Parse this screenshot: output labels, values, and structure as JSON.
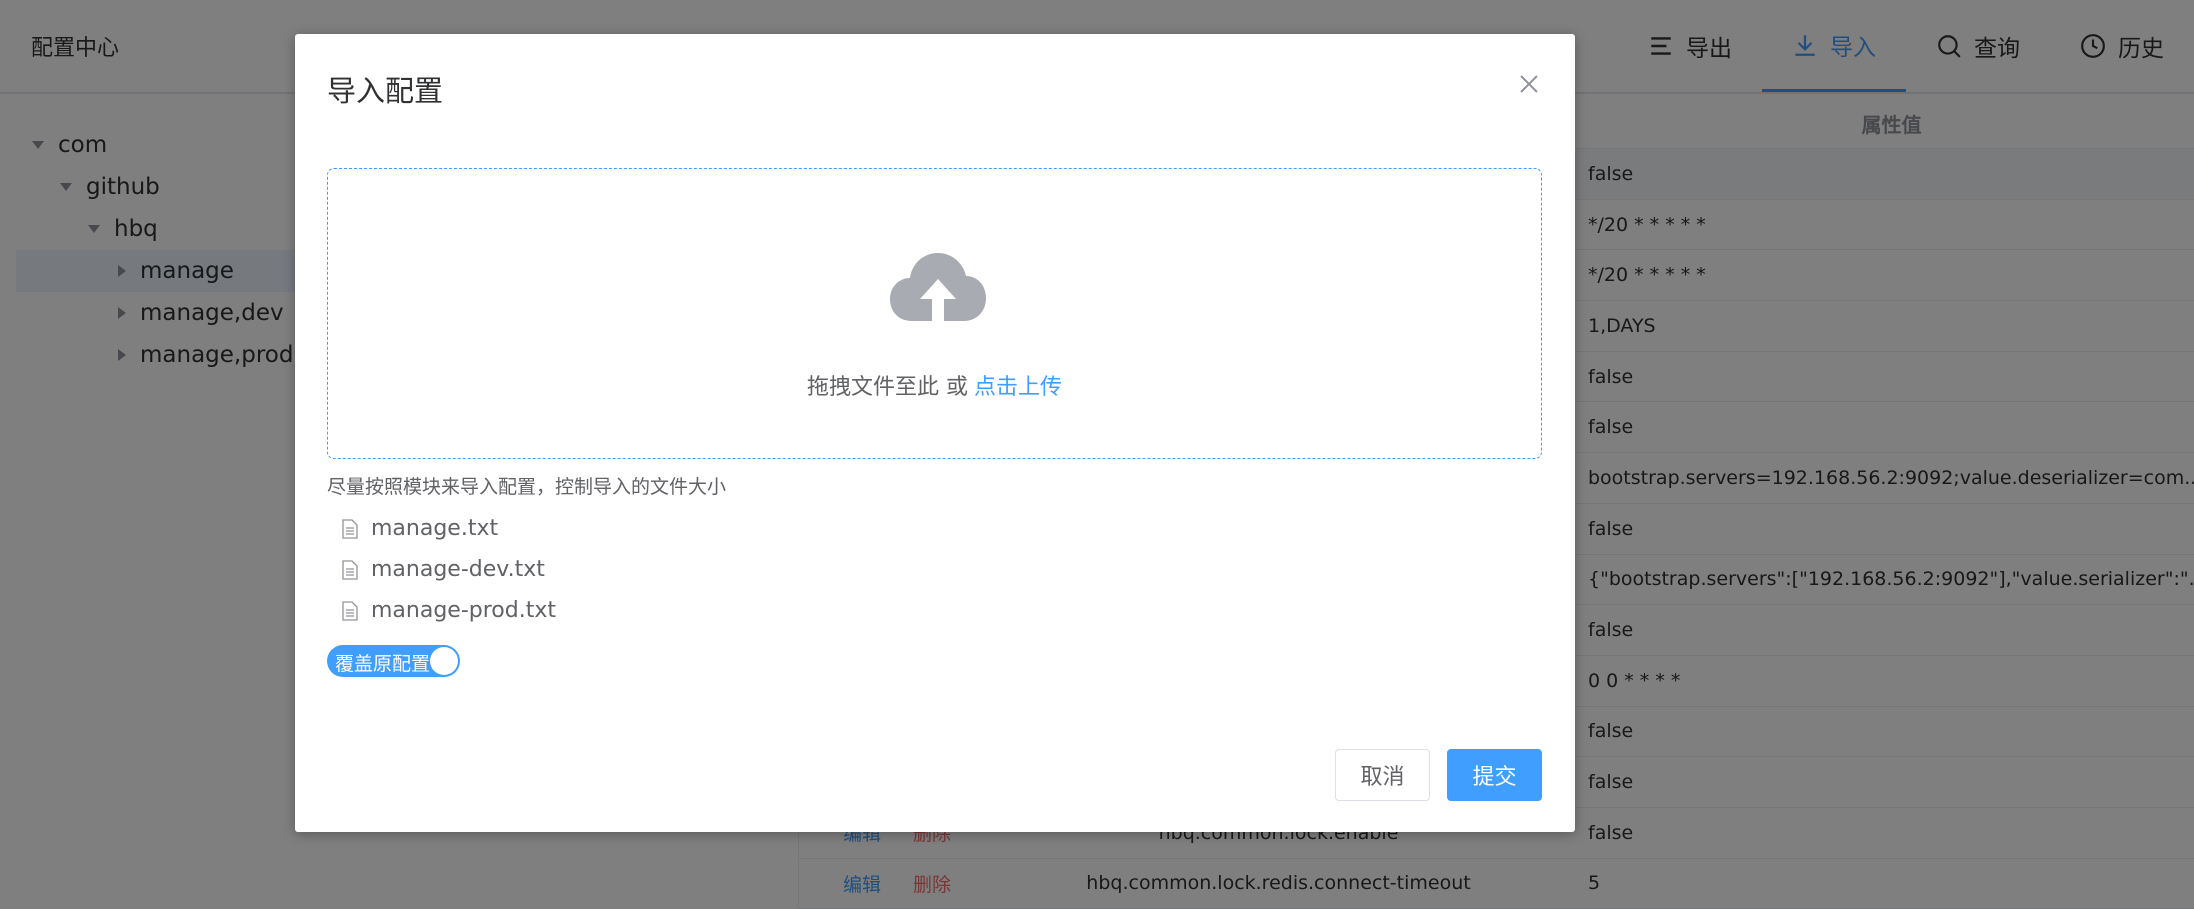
{
  "app": {
    "title": "配置中心"
  },
  "nav": [
    {
      "label": "导出",
      "icon": "export-icon",
      "active": false
    },
    {
      "label": "导入",
      "icon": "import-icon",
      "active": true
    },
    {
      "label": "查询",
      "icon": "search-icon",
      "active": false
    },
    {
      "label": "历史",
      "icon": "history-icon",
      "active": false
    }
  ],
  "tree": [
    {
      "label": "com",
      "expanded": true,
      "level": 0
    },
    {
      "label": "github",
      "expanded": true,
      "level": 1
    },
    {
      "label": "hbq",
      "expanded": true,
      "level": 2
    },
    {
      "label": "manage",
      "expanded": false,
      "level": 3,
      "selected": true
    },
    {
      "label": "manage,dev",
      "expanded": false,
      "level": 3
    },
    {
      "label": "manage,prod",
      "expanded": false,
      "level": 3
    }
  ],
  "table": {
    "value_header": "属性值",
    "edit_label": "编辑",
    "delete_label": "删除",
    "rows": [
      {
        "key": "",
        "value": "false"
      },
      {
        "key": "",
        "value": "*/20 * * * * *"
      },
      {
        "key": "",
        "value": "*/20 * * * * *"
      },
      {
        "key": "",
        "value": "1,DAYS"
      },
      {
        "key": "",
        "value": "false"
      },
      {
        "key": "",
        "value": "false"
      },
      {
        "key": "",
        "value": "bootstrap.servers=192.168.56.2:9092;value.deserializer=com..."
      },
      {
        "key": "",
        "value": "false"
      },
      {
        "key": "",
        "value": "{\"bootstrap.servers\":[\"192.168.56.2:9092\"],\"value.serializer\":\"..."
      },
      {
        "key": "",
        "value": "false"
      },
      {
        "key": "",
        "value": "0 0 * * * *"
      },
      {
        "key": "",
        "value": "false"
      },
      {
        "key": "",
        "value": "false"
      },
      {
        "key": "hbq.common.lock.enable",
        "value": "false"
      },
      {
        "key": "hbq.common.lock.redis.connect-timeout",
        "value": "5"
      }
    ]
  },
  "dialog": {
    "title": "导入配置",
    "upload_text": "拖拽文件至此 或",
    "upload_link": "点击上传",
    "tip": "尽量按照模块来导入配置，控制导入的文件大小",
    "files": [
      "manage.txt",
      "manage-dev.txt",
      "manage-prod.txt"
    ],
    "switch_label": "覆盖原配置",
    "switch_on": true,
    "cancel_label": "取消",
    "submit_label": "提交"
  }
}
